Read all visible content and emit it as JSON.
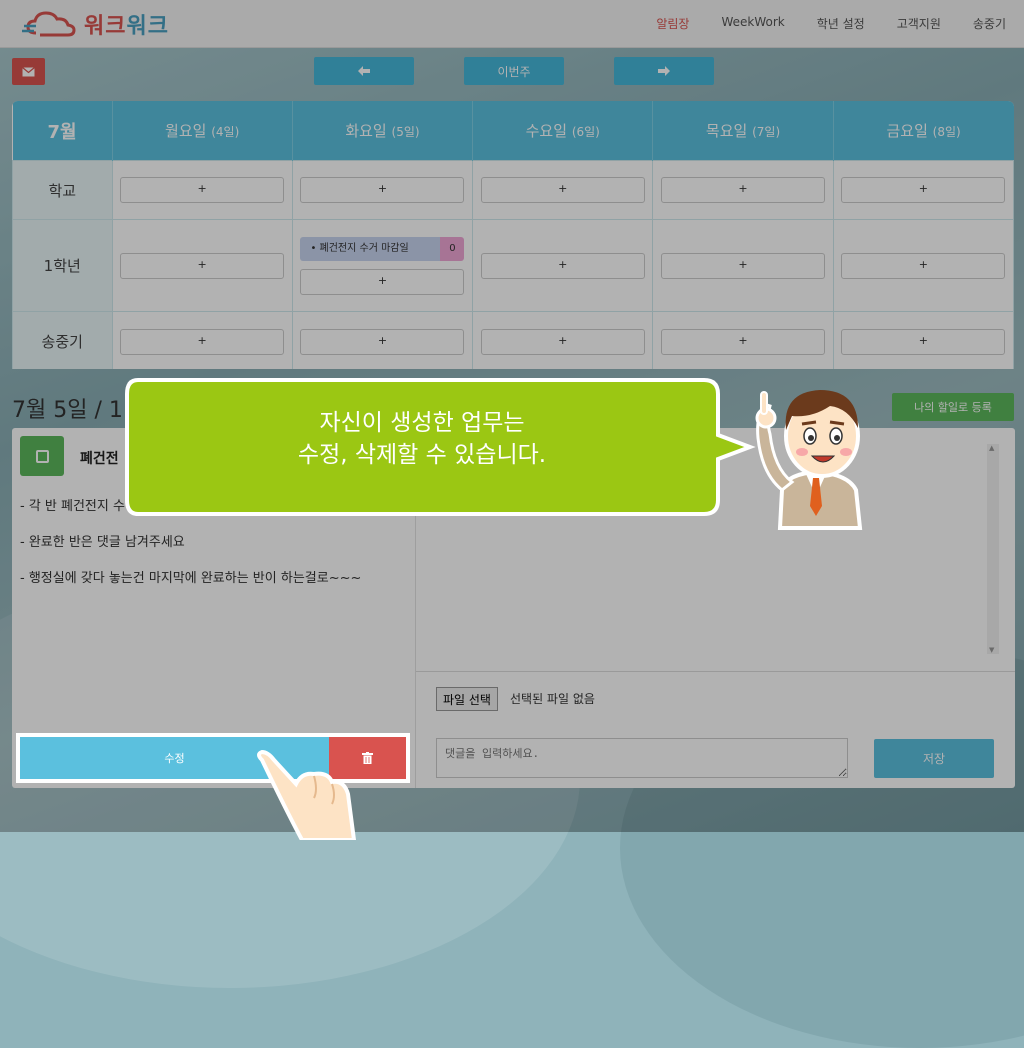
{
  "nav": {
    "logo_text_a": "워크",
    "logo_text_b": "워크",
    "links": [
      "알림장",
      "WeekWork",
      "학년 설정",
      "고객지원",
      "송중기"
    ],
    "active_color": "#d9534f"
  },
  "toolbar": {
    "mail_icon": "envelope-icon",
    "prev_icon": "arrow-left-icon",
    "this_week": "이번주",
    "next_icon": "arrow-right-icon"
  },
  "calendar": {
    "month": "7월",
    "days": [
      {
        "name": "월요일",
        "date": "(4일)"
      },
      {
        "name": "화요일",
        "date": "(5일)"
      },
      {
        "name": "수요일",
        "date": "(6일)"
      },
      {
        "name": "목요일",
        "date": "(7일)"
      },
      {
        "name": "금요일",
        "date": "(8일)"
      }
    ],
    "rows": [
      "학교",
      "1학년",
      "송중기"
    ],
    "add_label": "+",
    "task": {
      "title": "• 폐건전지 수거 마감일",
      "count": "0"
    },
    "header_color": "#5bc0de"
  },
  "detail": {
    "date_title": "7월 5일 / 1",
    "mine_button": "나의 할일로 등록",
    "task_title": "폐건전",
    "lines": [
      "- 각 반 폐건전지 수",
      "- 완료한 반은 댓글 남겨주세요",
      "- 행정실에 갖다 놓는건 마지막에 완료하는 반이 하는걸로~~~"
    ],
    "edit_label": "수정",
    "delete_icon": "trash-icon",
    "file_button": "파일 선택",
    "file_status": "선택된 파일 없음",
    "comment_placeholder": "댓글을 입력하세요.",
    "save_label": "저장"
  },
  "tutorial": {
    "line1": "자신이 생성한 업무는",
    "line2": "수정, 삭제할 수 있습니다.",
    "bubble_color": "#9bc713"
  }
}
